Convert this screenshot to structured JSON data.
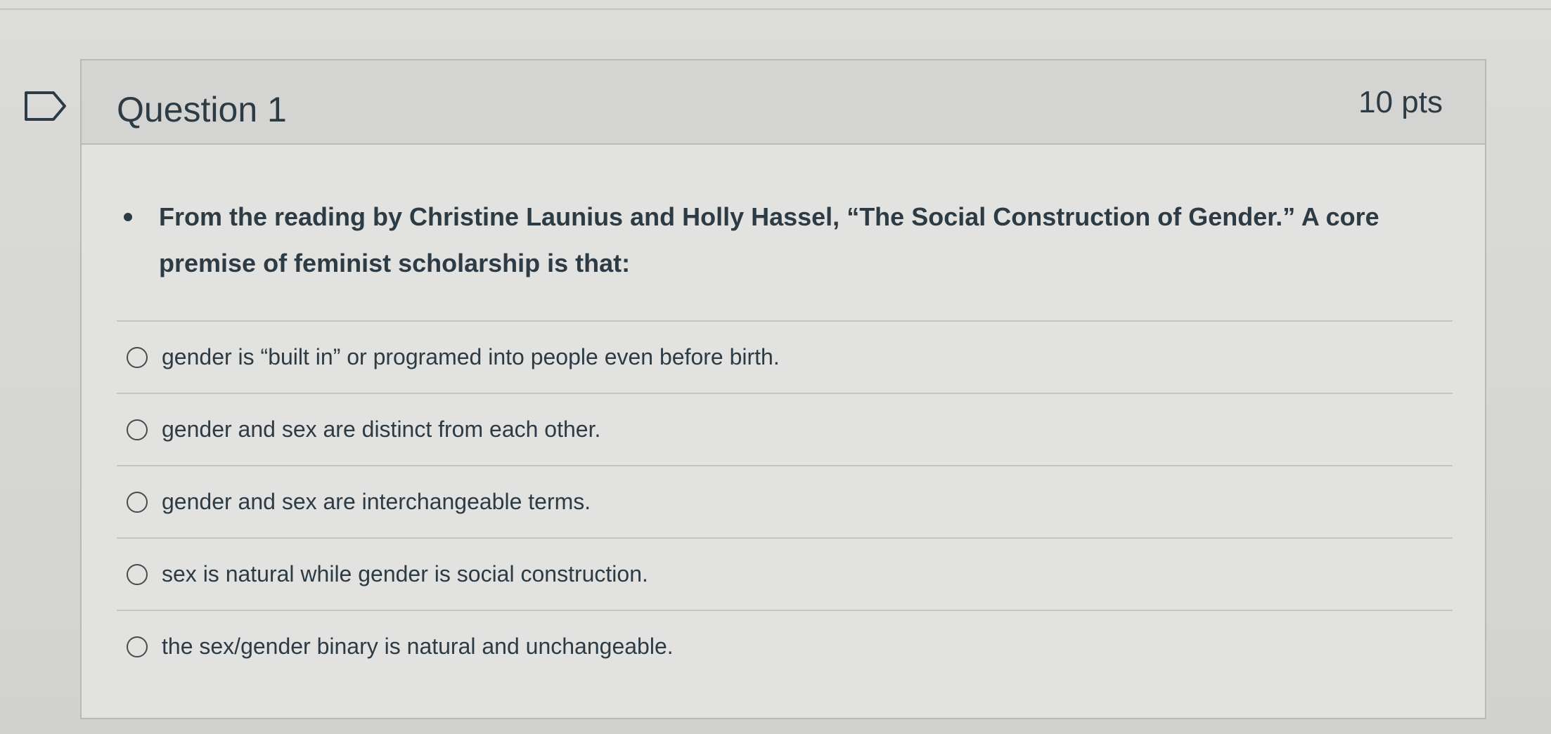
{
  "question": {
    "title": "Question 1",
    "points": "10 pts",
    "text": "From the reading by Christine Launius and Holly Hassel, “The Social Construction of Gender.” A core premise of feminist scholarship is that:",
    "flag_icon": "flag-icon"
  },
  "answers": [
    {
      "label": "gender is “built in” or programed into people even before birth."
    },
    {
      "label": "gender and sex are distinct from each other."
    },
    {
      "label": "gender and sex are interchangeable terms."
    },
    {
      "label": "sex is natural while gender is social construction."
    },
    {
      "label": "the sex/gender binary is natural and unchangeable."
    }
  ],
  "colors": {
    "text": "#2d3b45",
    "header_bg": "#d4d4d2",
    "card_bg": "#e2e2e0",
    "border": "#b9b9b7"
  }
}
